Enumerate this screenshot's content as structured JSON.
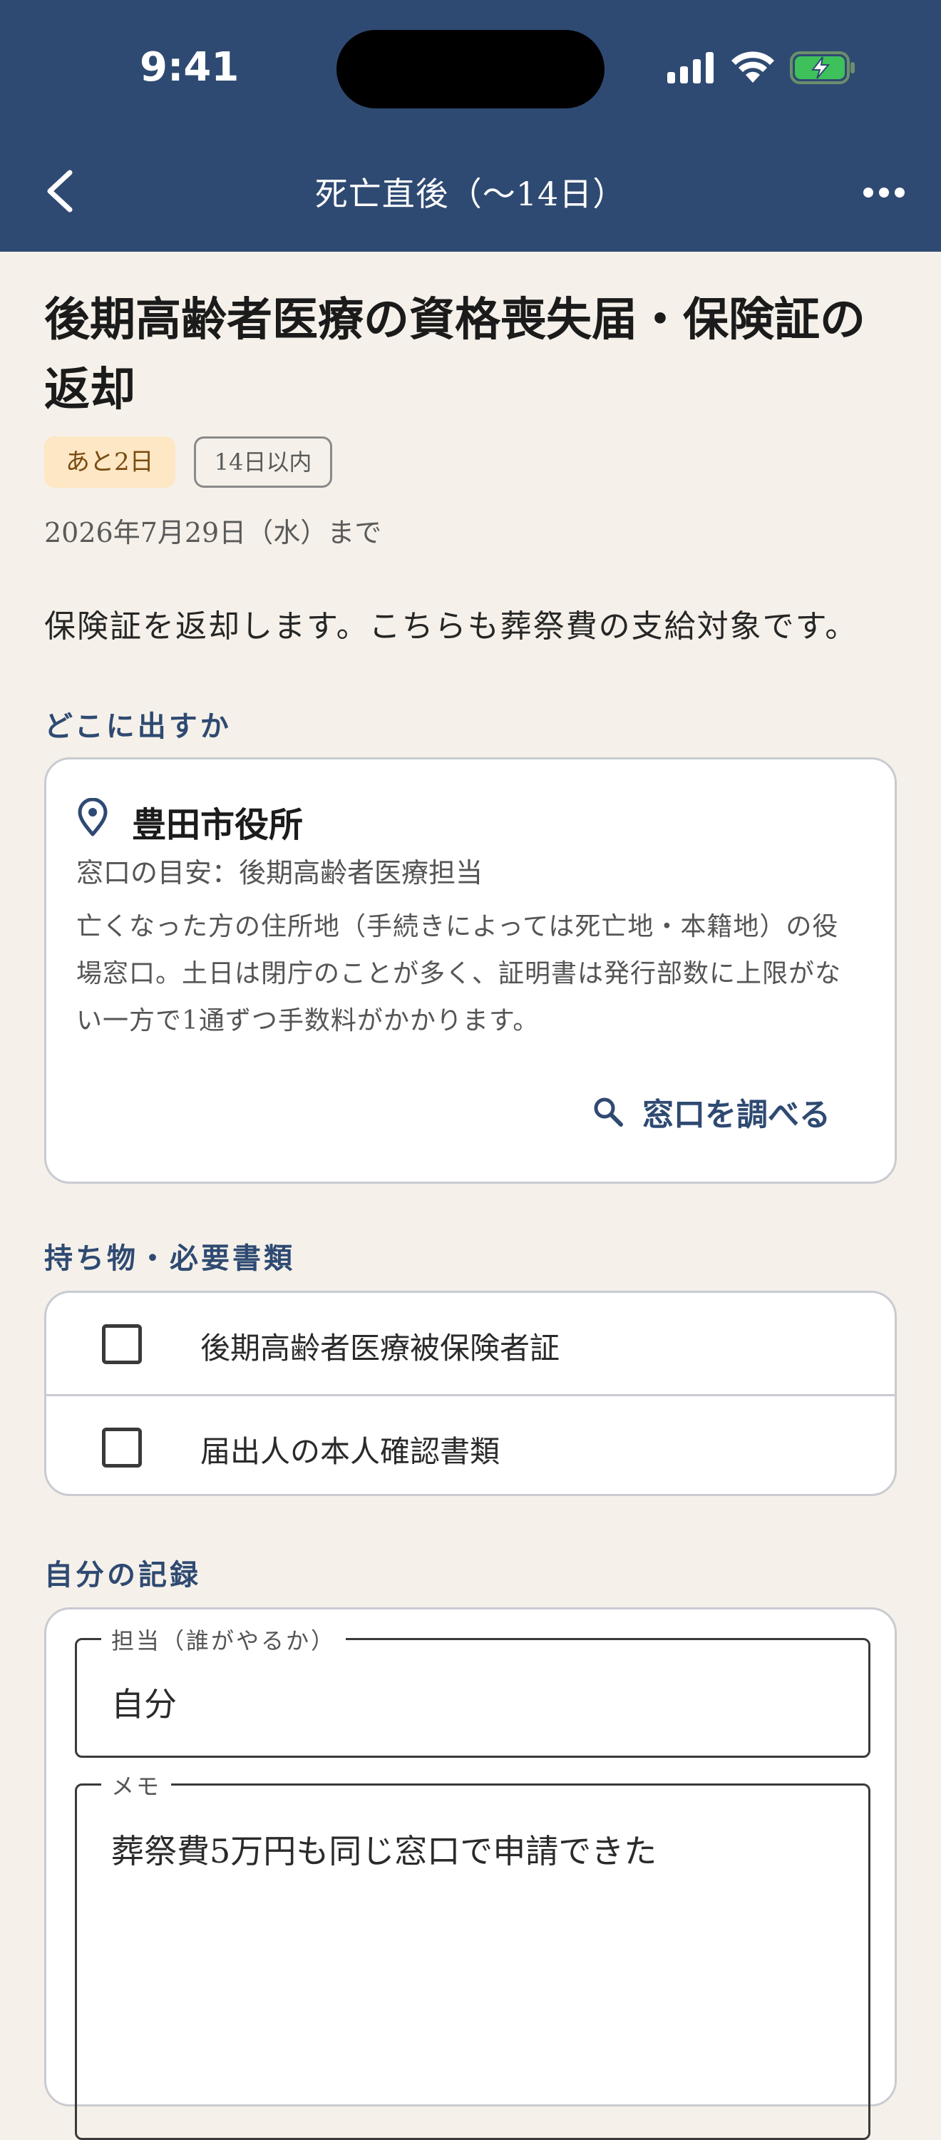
{
  "status_bar": {
    "time": "9:41"
  },
  "header": {
    "title": "死亡直後（〜14日）"
  },
  "task": {
    "title": "後期高齢者医療の資格喪失届・保険証の返却",
    "badge_remaining": "あと2日",
    "badge_period": "14日以内",
    "deadline": "2026年7月29日（水）まで",
    "description": "保険証を返却します。こちらも葬祭費の支給対象です。"
  },
  "where": {
    "section_label": "どこに出すか",
    "office_name": "豊田市役所",
    "counter_hint": "窓口の目安：後期高齢者医療担当",
    "note_lines": [
      "亡くなった方の住所地（手続きによっては死亡地・本籍地）の役",
      "場窓口。土日は閉庁のことが多く、証明書は発行部数に上限がな",
      "い一方で1通ずつ手数料がかかります。"
    ],
    "lookup_label": "窓口を調べる"
  },
  "documents": {
    "section_label": "持ち物・必要書類",
    "items": [
      {
        "label": "後期高齢者医療被保険者証",
        "checked": false
      },
      {
        "label": "届出人の本人確認書類",
        "checked": false
      }
    ]
  },
  "record": {
    "section_label": "自分の記録",
    "assignee_label": "担当（誰がやるか）",
    "assignee_value": "自分",
    "memo_label": "メモ",
    "memo_value": "葬祭費5万円も同じ窓口で申請できた"
  },
  "colors": {
    "header_bg": "#2f4a72",
    "accent": "#2f4a72",
    "warn_bg": "#fde7c4",
    "page_bg": "#f5f1ea"
  }
}
